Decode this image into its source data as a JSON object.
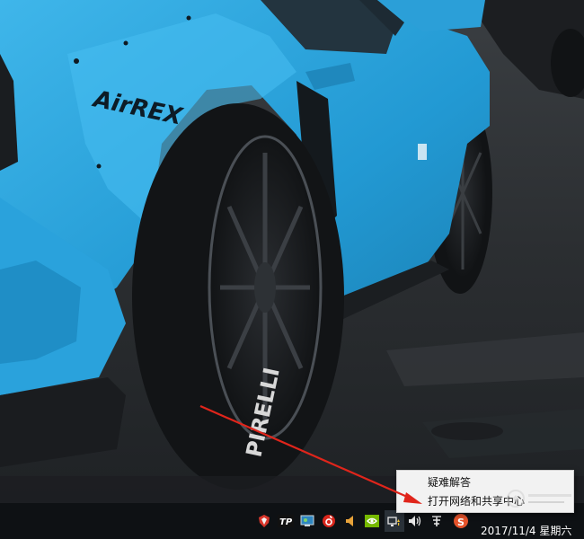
{
  "wallpaper": {
    "decal_text": "AirREX",
    "tire_text": "PIRELLI",
    "colors": {
      "car_body": "#2aa7df",
      "ground": "#2c2f33",
      "wheel": "#16181b"
    }
  },
  "context_menu": {
    "items": [
      {
        "label": "疑难解答"
      },
      {
        "label": "打开网络和共享中心"
      }
    ]
  },
  "taskbar": {
    "tray_icons": [
      {
        "name": "app-shield-icon"
      },
      {
        "name": "app-tp-icon"
      },
      {
        "name": "app-monitor-icon"
      },
      {
        "name": "netease-music-icon"
      },
      {
        "name": "speaker-icon"
      },
      {
        "name": "nvidia-icon"
      },
      {
        "name": "network-icon"
      },
      {
        "name": "volume-icon"
      },
      {
        "name": "input-method-icon"
      },
      {
        "name": "sogou-icon"
      }
    ],
    "clock": "2017/11/4 星期六",
    "background": "#0e1114"
  },
  "annotation": {
    "arrow_color": "#e0251b"
  }
}
